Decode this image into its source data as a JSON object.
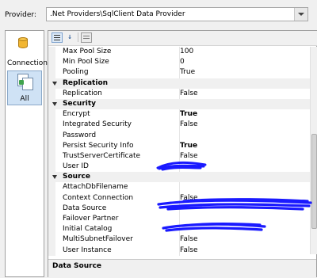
{
  "provider": {
    "label": "Provider:",
    "value": ".Net Providers\\SqlClient Data Provider"
  },
  "nav": {
    "connection_label": "Connection",
    "all_label": "All"
  },
  "properties": [
    {
      "type": "prop",
      "name": "Max Pool Size",
      "value": "100",
      "bold": false
    },
    {
      "type": "prop",
      "name": "Min Pool Size",
      "value": "0",
      "bold": false
    },
    {
      "type": "prop",
      "name": "Pooling",
      "value": "True",
      "bold": false
    },
    {
      "type": "cat",
      "name": "Replication"
    },
    {
      "type": "prop",
      "name": "Replication",
      "value": "False",
      "bold": false
    },
    {
      "type": "cat",
      "name": "Security"
    },
    {
      "type": "prop",
      "name": "Encrypt",
      "value": "True",
      "bold": true
    },
    {
      "type": "prop",
      "name": "Integrated Security",
      "value": "False",
      "bold": false
    },
    {
      "type": "prop",
      "name": "Password",
      "value": "",
      "bold": false
    },
    {
      "type": "prop",
      "name": "Persist Security Info",
      "value": "True",
      "bold": true
    },
    {
      "type": "prop",
      "name": "TrustServerCertificate",
      "value": "False",
      "bold": false
    },
    {
      "type": "prop",
      "name": "User ID",
      "value": "",
      "bold": false
    },
    {
      "type": "cat",
      "name": "Source"
    },
    {
      "type": "prop",
      "name": "AttachDbFilename",
      "value": "",
      "bold": false
    },
    {
      "type": "prop",
      "name": "Context Connection",
      "value": "False",
      "bold": false
    },
    {
      "type": "prop",
      "name": "Data Source",
      "value": "",
      "bold": false
    },
    {
      "type": "prop",
      "name": "Failover Partner",
      "value": "",
      "bold": false
    },
    {
      "type": "prop",
      "name": "Initial Catalog",
      "value": "",
      "bold": false
    },
    {
      "type": "prop",
      "name": "MultiSubnetFailover",
      "value": "False",
      "bold": false
    },
    {
      "type": "prop",
      "name": "User Instance",
      "value": "False",
      "bold": false
    }
  ],
  "description": {
    "title": "Data Source"
  },
  "colors": {
    "redaction": "#1a1aff",
    "selected_nav": "#cfe2f5"
  }
}
